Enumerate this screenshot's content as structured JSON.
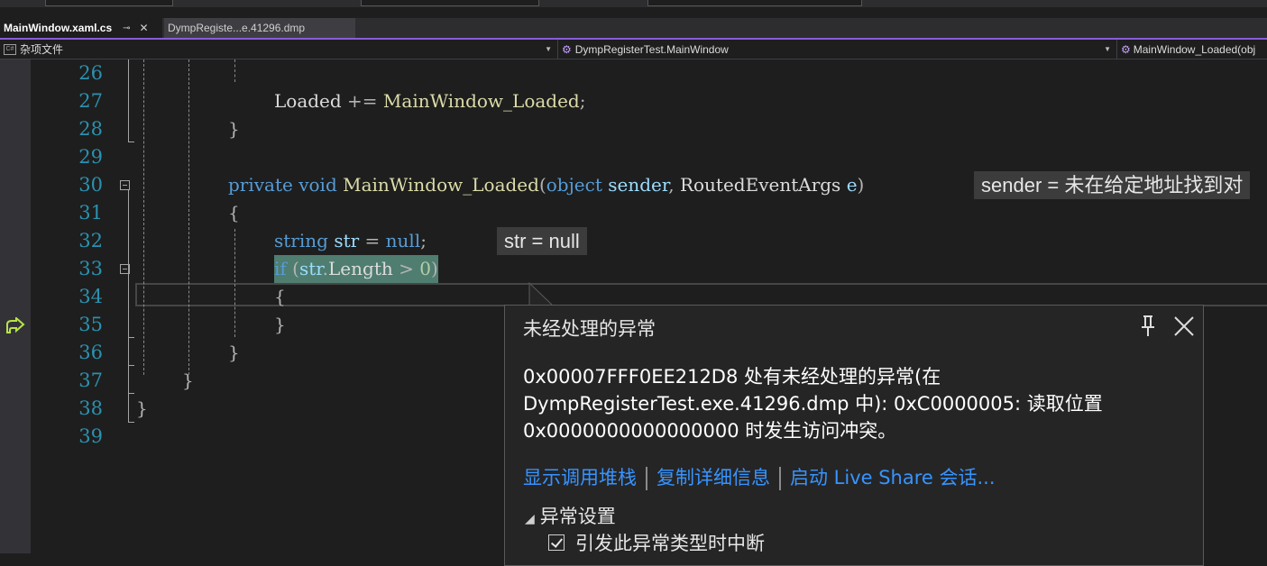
{
  "tabs": [
    {
      "label": "MainWindow.xaml.cs",
      "active": true
    },
    {
      "label": "DympRegiste...e.41296.dmp",
      "active": false
    }
  ],
  "navbar": {
    "project": "杂项文件",
    "type": "DympRegisterTest.MainWindow",
    "member": "MainWindow_Loaded(obj"
  },
  "code_lines": [
    {
      "num": "26"
    },
    {
      "num": "27",
      "parts": [
        "Loaded",
        " += ",
        "MainWindow_Loaded",
        ";"
      ]
    },
    {
      "num": "28",
      "parts": [
        "}"
      ]
    },
    {
      "num": "29"
    },
    {
      "num": "30",
      "parts": [
        "private",
        " ",
        "void",
        " ",
        "MainWindow_Loaded",
        "(",
        "object",
        " ",
        "sender",
        ", ",
        "RoutedEventArgs",
        " ",
        "e",
        ")"
      ]
    },
    {
      "num": "31",
      "parts": [
        "{"
      ]
    },
    {
      "num": "32",
      "parts": [
        "string",
        " ",
        "str",
        " = ",
        "null",
        ";"
      ]
    },
    {
      "num": "33",
      "parts": [
        "if",
        " (",
        "str",
        ".",
        "Length",
        " > ",
        "0",
        ")"
      ]
    },
    {
      "num": "34",
      "parts": [
        "{"
      ]
    },
    {
      "num": "35",
      "parts": [
        "}"
      ]
    },
    {
      "num": "36",
      "parts": [
        "}"
      ]
    },
    {
      "num": "37",
      "parts": [
        "}"
      ]
    },
    {
      "num": "38",
      "parts": [
        "}"
      ]
    },
    {
      "num": "39"
    }
  ],
  "datatips": {
    "sender": "sender = 未在给定地址找到对",
    "str": "str = null"
  },
  "exception": {
    "title": "未经处理的异常",
    "message": "0x00007FFF0EE212D8 处有未经处理的异常(在 DympRegisterTest.exe.41296.dmp 中): 0xC0000005: 读取位置 0x0000000000000000 时发生访问冲突。",
    "links": [
      "显示调用堆栈",
      "复制详细信息",
      "启动 Live Share 会话..."
    ],
    "section": "异常设置",
    "checkbox": "引发此异常类型时中断",
    "checked": true
  },
  "colors": {
    "accent": "#8a5cd6",
    "keyword": "#569cd6",
    "method": "#dcdcaa",
    "type": "#4ec9b0",
    "variable": "#9cdcfe",
    "link": "#3794ff",
    "line_number": "#2b91af"
  }
}
